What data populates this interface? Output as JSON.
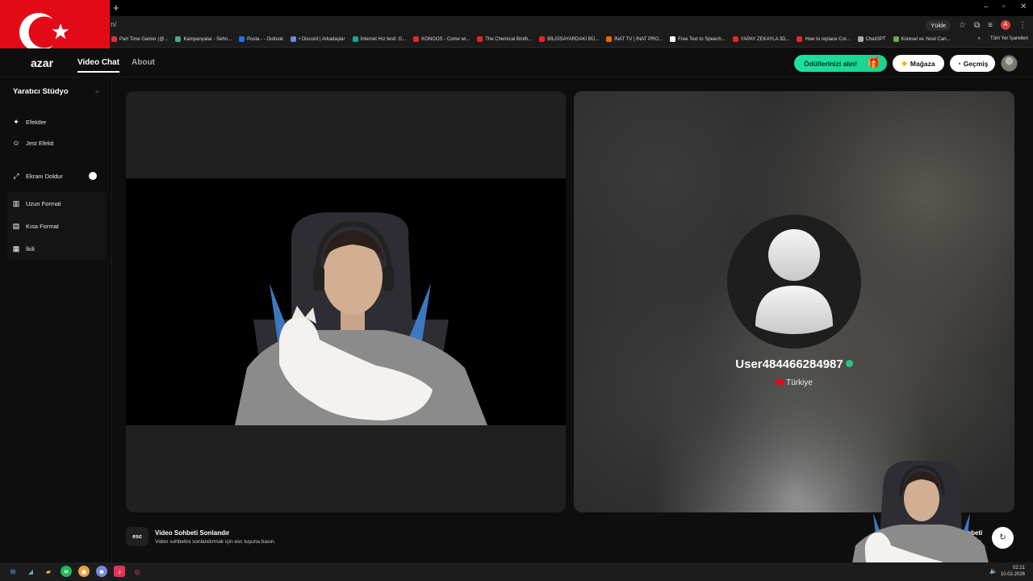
{
  "browser": {
    "url": "n/",
    "new_tab": "+",
    "window_controls": [
      "–",
      "▫",
      "✕"
    ],
    "yukle": "Yükle",
    "profile_letter": "A",
    "bookmarks": [
      {
        "label": "Part Time Gamer (@...",
        "color": "#d33"
      },
      {
        "label": "Kampanyalar - Sehn...",
        "color": "#4a8"
      },
      {
        "label": "Posta - - Outlook",
        "color": "#1a73e8"
      },
      {
        "label": "• Discord | Arkadaşlar",
        "color": "#7289da"
      },
      {
        "label": "İnternet Hız testi: G...",
        "color": "#1a9"
      },
      {
        "label": "KONGOS - Come wi...",
        "color": "#e22"
      },
      {
        "label": "The Chemical Broth...",
        "color": "#e22"
      },
      {
        "label": "BİLGİSAYARDAKİ BÜ...",
        "color": "#e22"
      },
      {
        "label": "İNAT TV | İNAT PRO...",
        "color": "#e60"
      },
      {
        "label": "Free Text to Speech...",
        "color": "#fff"
      },
      {
        "label": "YAPAY ZEKAYLA 3D...",
        "color": "#e22"
      },
      {
        "label": "How to replace Cor...",
        "color": "#e22"
      },
      {
        "label": "ChatGPT",
        "color": "#aaa"
      },
      {
        "label": "Küresel ve Yerel Can...",
        "color": "#6a4"
      }
    ],
    "bookmarks_more": "»",
    "all_bookmarks": "Tüm Yer İşaretleri"
  },
  "header": {
    "logo": "azar",
    "nav_active": "Video Chat",
    "nav_about": "About",
    "rewards": "Ödüllerinizi alın!",
    "shop": "Mağaza",
    "history": "Geçmiş"
  },
  "sidebar": {
    "title": "Yaratıcı Stüdyo",
    "collapse": "«",
    "items": [
      {
        "label": "Efektler",
        "icon": "magic-wand-icon"
      },
      {
        "label": "Jest Efekti",
        "icon": "smile-icon"
      },
      {
        "label": "Ekranı Doldur",
        "icon": "expand-icon"
      },
      {
        "label": "Uzun Format",
        "icon": "columns-icon"
      },
      {
        "label": "Kısa Format",
        "icon": "rows-icon"
      },
      {
        "label": "İkili",
        "icon": "grid-icon"
      }
    ]
  },
  "partner": {
    "username": "User484466284987",
    "country": "Türkiye"
  },
  "footer": {
    "esc_key": "esc",
    "esc_title": "Video Sohbeti Sonlandır",
    "esc_desc": "Video sohbetini sonlandırmak için esc tuşuna basın.",
    "right_title": "Sohbeti",
    "right_desc": "basın",
    "next_icon": "↻"
  },
  "taskbar": {
    "time": "02:21",
    "date": "10.02.2026"
  },
  "colors": {
    "accent_green": "#1fe1a0",
    "flag_red": "#e30a17"
  }
}
